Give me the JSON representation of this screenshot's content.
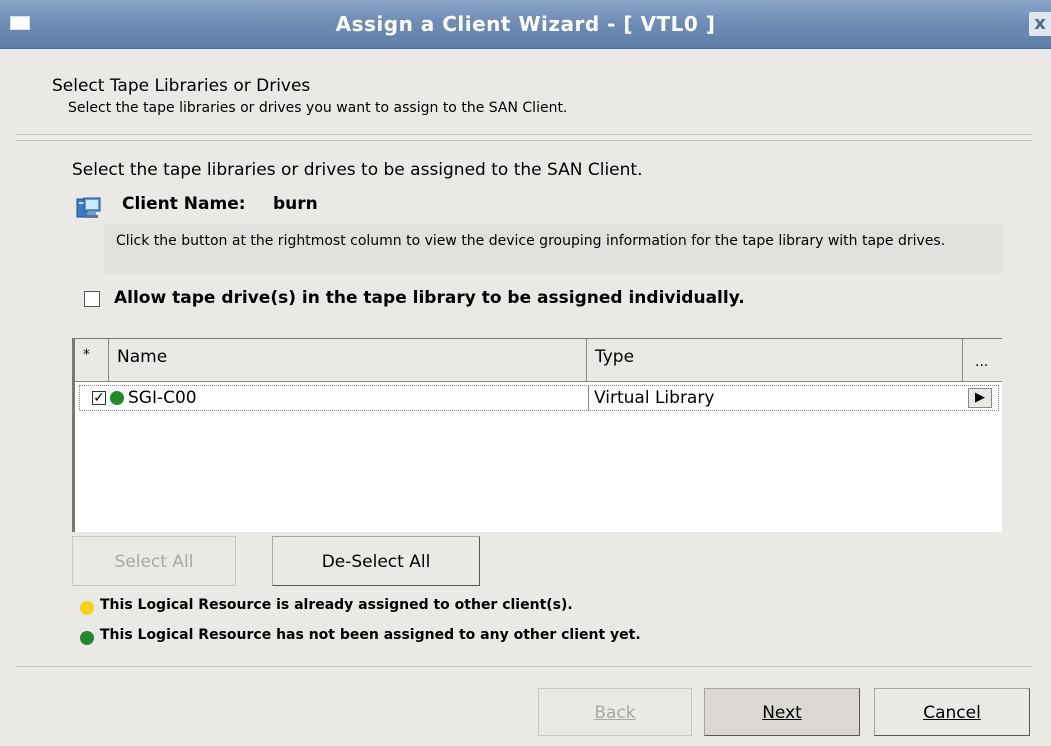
{
  "window": {
    "title": "Assign a Client Wizard - [ VTL0 ]",
    "close_glyph": "x",
    "menu_icon": "window-menu-icon"
  },
  "header": {
    "title": "Select Tape Libraries or Drives",
    "subtitle": "Select the tape libraries or drives you want to assign to the SAN Client."
  },
  "body": {
    "instruction": "Select the tape libraries or drives to be assigned to the SAN Client.",
    "client_name_label": "Client Name:",
    "client_name_value": "burn",
    "client_icon": "computer-icon",
    "hint": "Click the button at the rightmost column to view the device grouping information for the tape library with tape drives.",
    "allow_individual_label": "Allow tape drive(s) in the tape library to be assigned individually.",
    "allow_individual_checked": false
  },
  "table": {
    "columns": [
      "*",
      "Name",
      "Type",
      "..."
    ],
    "rows": [
      {
        "checked": true,
        "check_glyph": "✓",
        "status_color": "#1e8a2a",
        "name": "SGI-C00",
        "type": "Virtual Library",
        "expand_glyph": "▶"
      }
    ]
  },
  "buttons": {
    "select_all": "Select All",
    "deselect_all": "De-Select All",
    "back": "Back",
    "next": "Next",
    "cancel": "Cancel"
  },
  "legend": [
    {
      "color": "#f5d21a",
      "text": "This Logical Resource is already assigned to other client(s)."
    },
    {
      "color": "#1e8a2a",
      "text": "This Logical Resource has not been assigned to any other client yet."
    }
  ],
  "colors": {
    "titlebar": "#6f8db5",
    "assigned": "#f5d21a",
    "unassigned": "#1e8a2a"
  }
}
